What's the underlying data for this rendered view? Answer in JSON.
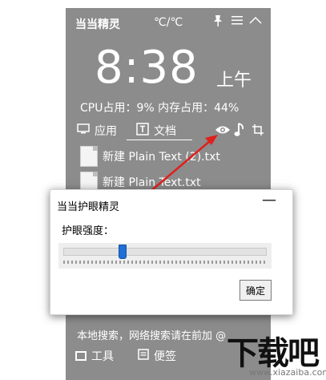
{
  "widget": {
    "app_name": "当当精灵",
    "temperature": "℃/℃",
    "time": "8:38",
    "ampm": "上午",
    "system_info": "CPU占用：9%  内存占用：44%",
    "nav": {
      "apps": "应用",
      "docs": "文档"
    },
    "files": [
      "新建 Plain Text (2).txt",
      "新建 Plain Text.txt"
    ],
    "search_hint": "本地搜索，网络搜索请在前加 @",
    "bottom": {
      "tools": "工具",
      "notes": "便签"
    },
    "icons": [
      "pin-icon",
      "menu-icon",
      "collapse-icon",
      "monitor-icon",
      "text-icon",
      "eye-icon",
      "music-icon",
      "crop-icon"
    ]
  },
  "dialog": {
    "title": "当当护眼精灵",
    "minimize": "—",
    "label": "护眼强度：",
    "slider_value": 0.29,
    "ok_button": "确定"
  },
  "watermark": {
    "main": "下载吧",
    "sub": "www.xiazaiba.com"
  },
  "colors": {
    "panel": "#8c8c8c",
    "accent": "#1f6fd6",
    "arrow": "#e0201c"
  }
}
